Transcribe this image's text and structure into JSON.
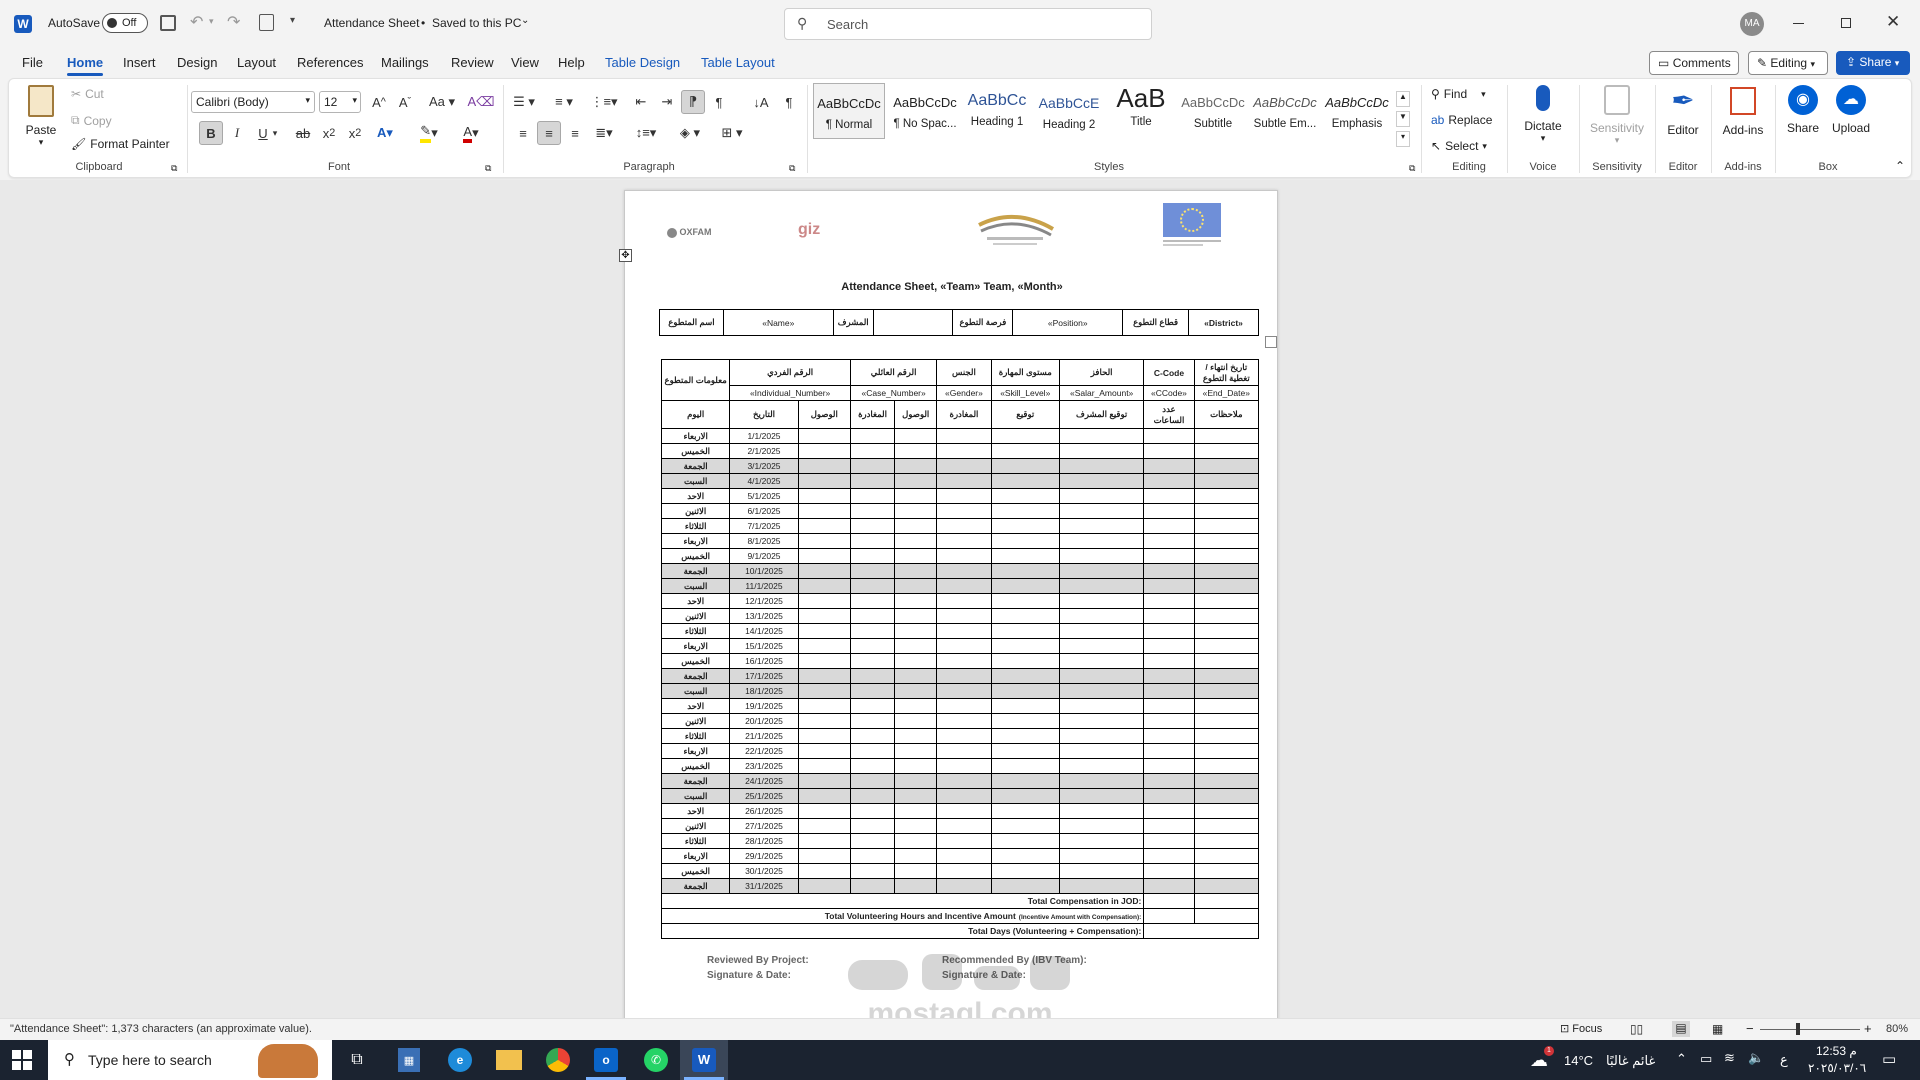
{
  "titlebar": {
    "autosave_label": "AutoSave",
    "autosave_state": "Off",
    "doc_title": "Attendance Sheet",
    "save_status": "Saved to this PC",
    "search_placeholder": "Search",
    "avatar_initials": "MA"
  },
  "menu": {
    "items": [
      "File",
      "Home",
      "Insert",
      "Design",
      "Layout",
      "References",
      "Mailings",
      "Review",
      "View",
      "Help",
      "Table Design",
      "Table Layout"
    ],
    "active": "Home",
    "comments_label": "Comments",
    "editing_label": "Editing",
    "share_label": "Share"
  },
  "ribbon": {
    "clipboard": {
      "paste": "Paste",
      "cut": "Cut",
      "copy": "Copy",
      "format_painter": "Format Painter",
      "label": "Clipboard"
    },
    "font": {
      "font_name": "Calibri (Body)",
      "font_size": "12",
      "label": "Font"
    },
    "paragraph": {
      "label": "Paragraph"
    },
    "styles": {
      "label": "Styles",
      "items": [
        {
          "preview": "AaBbCcDc",
          "name": "¶ Normal"
        },
        {
          "preview": "AaBbCcDc",
          "name": "¶ No Spac..."
        },
        {
          "preview": "AaBbCc",
          "name": "Heading 1"
        },
        {
          "preview": "AaBbCcE",
          "name": "Heading 2"
        },
        {
          "preview": "AaB",
          "name": "Title"
        },
        {
          "preview": "AaBbCcDc",
          "name": "Subtitle"
        },
        {
          "preview": "AaBbCcDc",
          "name": "Subtle Em..."
        },
        {
          "preview": "AaBbCcDc",
          "name": "Emphasis"
        }
      ]
    },
    "editing": {
      "find": "Find",
      "replace": "Replace",
      "select": "Select",
      "label": "Editing"
    },
    "voice": {
      "dictate": "Dictate",
      "label": "Voice"
    },
    "sensitivity": {
      "button": "Sensitivity",
      "label": "Sensitivity"
    },
    "editor": {
      "button": "Editor",
      "label": "Editor"
    },
    "addins": {
      "button": "Add-ins",
      "label": "Add-ins"
    },
    "box": {
      "share": "Share",
      "upload": "Upload",
      "label": "Box"
    }
  },
  "document": {
    "logos": [
      "OXFAM",
      "giz"
    ],
    "title": "Attendance Sheet, «Team» Team,  «Month»",
    "header_row": [
      "«District»",
      "قطاع التطوع",
      "«Position»",
      "فرصة التطوع",
      "",
      "المشرف",
      "«Name»",
      "اسم المتطوع"
    ],
    "info_headers": [
      "تاريخ انتهاء /تغطية التطوع",
      "C-Code",
      "الحافز",
      "مستوى المهارة",
      "الجنس",
      "الرقم العائلي",
      "الرقم الفردي",
      "معلومات المتطوع"
    ],
    "info_values": [
      "«End_Date»",
      "«CCode»",
      "«Salar_Amount»",
      "«Skill_Level»",
      "«Gender»",
      "«Case_Number»",
      "«Individual_Number»"
    ],
    "log_headers": [
      "ملاحظات",
      "عدد الساعات",
      "توقيع المشرف",
      "توقيع",
      "المغادرة",
      "الوصول",
      "المغادرة",
      "الوصول",
      "التاريخ",
      "اليوم"
    ],
    "days": [
      [
        "الاربعاء",
        "1/1/2025",
        false
      ],
      [
        "الخميس",
        "2/1/2025",
        false
      ],
      [
        "الجمعة",
        "3/1/2025",
        true
      ],
      [
        "السبت",
        "4/1/2025",
        true
      ],
      [
        "الاحد",
        "5/1/2025",
        false
      ],
      [
        "الاثنين",
        "6/1/2025",
        false
      ],
      [
        "الثلاثاء",
        "7/1/2025",
        false
      ],
      [
        "الاربعاء",
        "8/1/2025",
        false
      ],
      [
        "الخميس",
        "9/1/2025",
        false
      ],
      [
        "الجمعة",
        "10/1/2025",
        true
      ],
      [
        "السبت",
        "11/1/2025",
        true
      ],
      [
        "الاحد",
        "12/1/2025",
        false
      ],
      [
        "الاثنين",
        "13/1/2025",
        false
      ],
      [
        "الثلاثاء",
        "14/1/2025",
        false
      ],
      [
        "الاربعاء",
        "15/1/2025",
        false
      ],
      [
        "الخميس",
        "16/1/2025",
        false
      ],
      [
        "الجمعة",
        "17/1/2025",
        true
      ],
      [
        "السبت",
        "18/1/2025",
        true
      ],
      [
        "الاحد",
        "19/1/2025",
        false
      ],
      [
        "الاثنين",
        "20/1/2025",
        false
      ],
      [
        "الثلاثاء",
        "21/1/2025",
        false
      ],
      [
        "الاربعاء",
        "22/1/2025",
        false
      ],
      [
        "الخميس",
        "23/1/2025",
        false
      ],
      [
        "الجمعة",
        "24/1/2025",
        true
      ],
      [
        "السبت",
        "25/1/2025",
        true
      ],
      [
        "الاحد",
        "26/1/2025",
        false
      ],
      [
        "الاثنين",
        "27/1/2025",
        false
      ],
      [
        "الثلاثاء",
        "28/1/2025",
        false
      ],
      [
        "الاربعاء",
        "29/1/2025",
        false
      ],
      [
        "الخميس",
        "30/1/2025",
        false
      ],
      [
        "الجمعة",
        "31/1/2025",
        true
      ]
    ],
    "totals": [
      "Total Compensation in JOD:",
      "Total Volunteering Hours and Incentive Amount",
      "(Incentive Amount with Compensation):",
      "Total Days (Volunteering + Compensation):"
    ],
    "footer": {
      "reviewed": "Reviewed By Project:",
      "sig_left": "Signature & Date:",
      "recommended": "Recommended By (IBV Team):",
      "sig_right": "Signature & Date:"
    },
    "watermark_text": "mostaql.com"
  },
  "statusbar": {
    "text": "\"Attendance Sheet\": 1,373 characters (an approximate value).",
    "focus": "Focus",
    "zoom": "80%"
  },
  "taskbar": {
    "search_placeholder": "Type here to search",
    "weather_temp": "14°C",
    "weather_desc": "غائم غالبًا",
    "lang": "ع",
    "time": "12:53 م",
    "date": "٢٠٢٥/٠٣/٠٦",
    "notif_count": "1"
  },
  "colors": {
    "accent": "#185abd",
    "ribbon_bg": "#ffffff",
    "shade": "#d9d9d9"
  }
}
